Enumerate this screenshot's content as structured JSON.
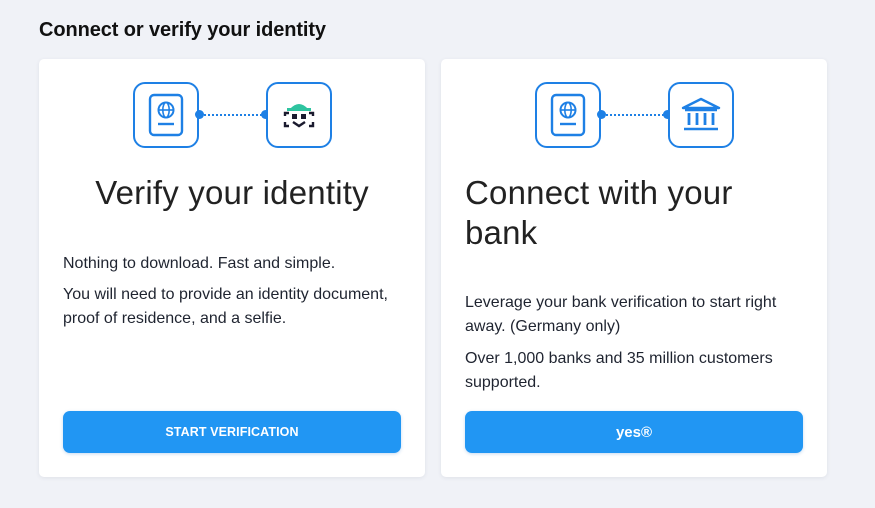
{
  "page": {
    "title": "Connect or verify your identity"
  },
  "colors": {
    "accent": "#2196f3",
    "icon_stroke": "#1e80e5",
    "background": "#f0f2f7",
    "card": "#ffffff",
    "mask_green": "#2ec4a0"
  },
  "cards": [
    {
      "title": "Verify your identity",
      "icons": [
        "passport-icon",
        "selfie-face-icon"
      ],
      "paragraphs": [
        "Nothing to download. Fast and simple.",
        "You will need to provide an identity document, proof of residence, and a selfie."
      ],
      "button_label": "START VERIFICATION"
    },
    {
      "title": "Connect with your bank",
      "icons": [
        "passport-icon",
        "bank-icon"
      ],
      "paragraphs": [
        "Leverage your bank verification to start right away. (Germany only)",
        "Over 1,000 banks and 35 million customers supported."
      ],
      "button_label": "yes®"
    }
  ]
}
